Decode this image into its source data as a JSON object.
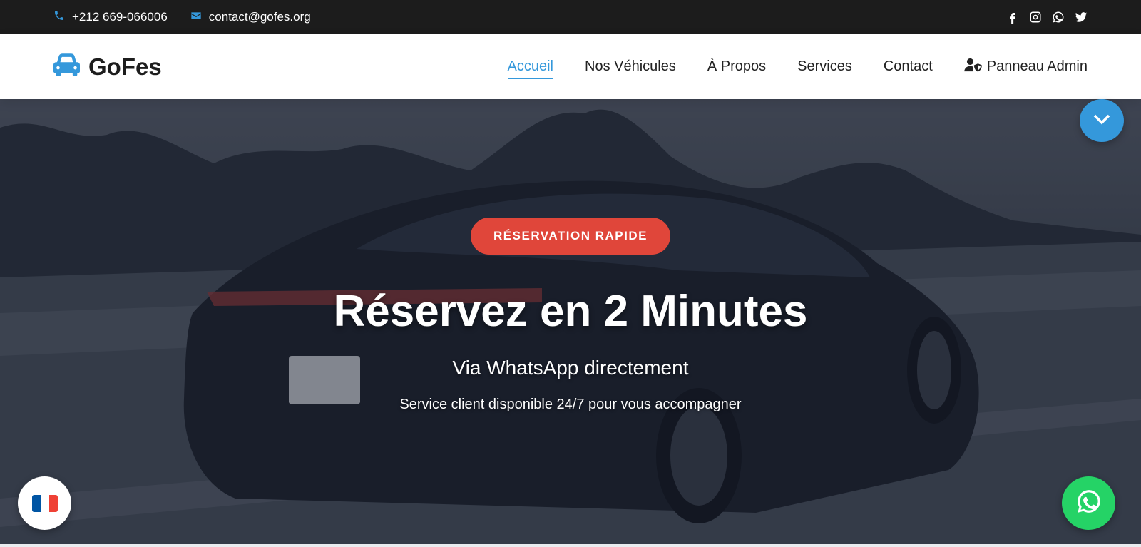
{
  "topbar": {
    "phone": "+212 669-066006",
    "email": "contact@gofes.org",
    "socials": [
      "facebook-icon",
      "instagram-icon",
      "whatsapp-icon",
      "twitter-icon"
    ]
  },
  "nav": {
    "brand": "GoFes",
    "links": [
      "Accueil",
      "Nos Véhicules",
      "À Propos",
      "Services",
      "Contact"
    ],
    "admin_label": "Panneau Admin",
    "active": "Accueil"
  },
  "hero": {
    "badge": "RÉSERVATION RAPIDE",
    "title": "Réservez en 2 Minutes",
    "subtitle": "Via WhatsApp directement",
    "description": "Service client disponible 24/7 pour vous accompagner"
  },
  "floating": {
    "language_flag": "france-flag-icon",
    "whatsapp": "whatsapp-icon",
    "scroll": "chevron-down-icon"
  },
  "colors": {
    "accent": "#3498db",
    "badge": "#e0463a",
    "whatsapp": "#25d366",
    "topbar": "#1c1c1c"
  }
}
